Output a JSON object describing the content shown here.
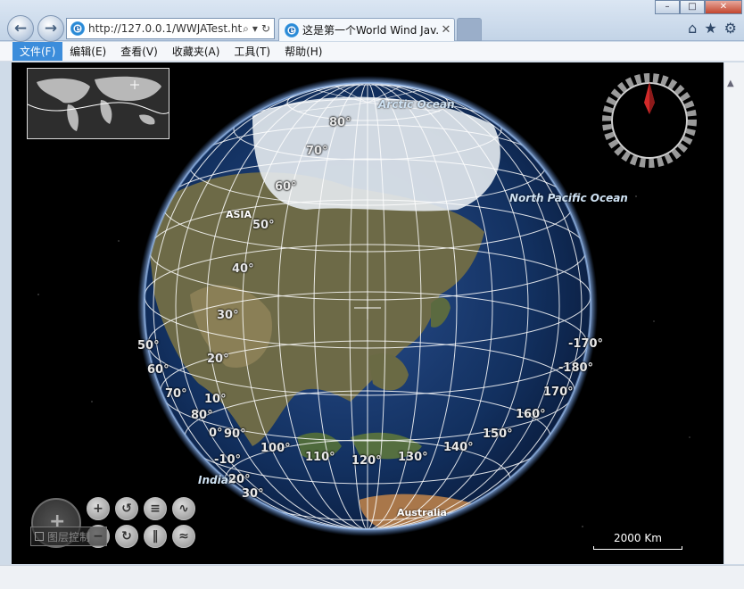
{
  "browser": {
    "address": "http://127.0.0.1/WWJATest.ht",
    "tab_title": "这是第一个World Wind Jav...",
    "tab_close": "✕"
  },
  "window_controls": {
    "minimize": "–",
    "maximize": "□",
    "close": "✕"
  },
  "menubar": {
    "items": [
      {
        "label": "文件(F)"
      },
      {
        "label": "编辑(E)"
      },
      {
        "label": "查看(V)"
      },
      {
        "label": "收藏夹(A)"
      },
      {
        "label": "工具(T)"
      },
      {
        "label": "帮助(H)"
      }
    ]
  },
  "globe": {
    "ocean_labels": {
      "north_pacific": "North Pacific Ocean",
      "indian": "Indian",
      "arctic": "Arctic Ocean"
    },
    "place_labels": {
      "asia": "ASIA",
      "australia": "Australia"
    },
    "lat_labels": [
      "80°",
      "70°",
      "60°",
      "50°",
      "40°",
      "30°",
      "20°",
      "10°",
      "0°",
      "-10°",
      "20°",
      "30°"
    ],
    "lon_labels": [
      "50°",
      "60°",
      "70°",
      "80°",
      "90°",
      "100°",
      "110°",
      "120°",
      "130°",
      "140°",
      "150°",
      "160°",
      "170°",
      "-180°",
      "-170°"
    ]
  },
  "controls": {
    "layer_control_label": "图层控制"
  },
  "scalebar": {
    "label": "2000 Km"
  },
  "icons": [
    "back-icon",
    "forward-icon",
    "ie-logo-icon",
    "search-icon",
    "refresh-icon",
    "home-icon",
    "favorites-icon",
    "settings-icon",
    "compass-icon",
    "zoom-in-icon",
    "zoom-out-icon",
    "rotate-left-icon",
    "rotate-right-icon",
    "tilt-icon",
    "vertical-exaggeration-icon"
  ]
}
